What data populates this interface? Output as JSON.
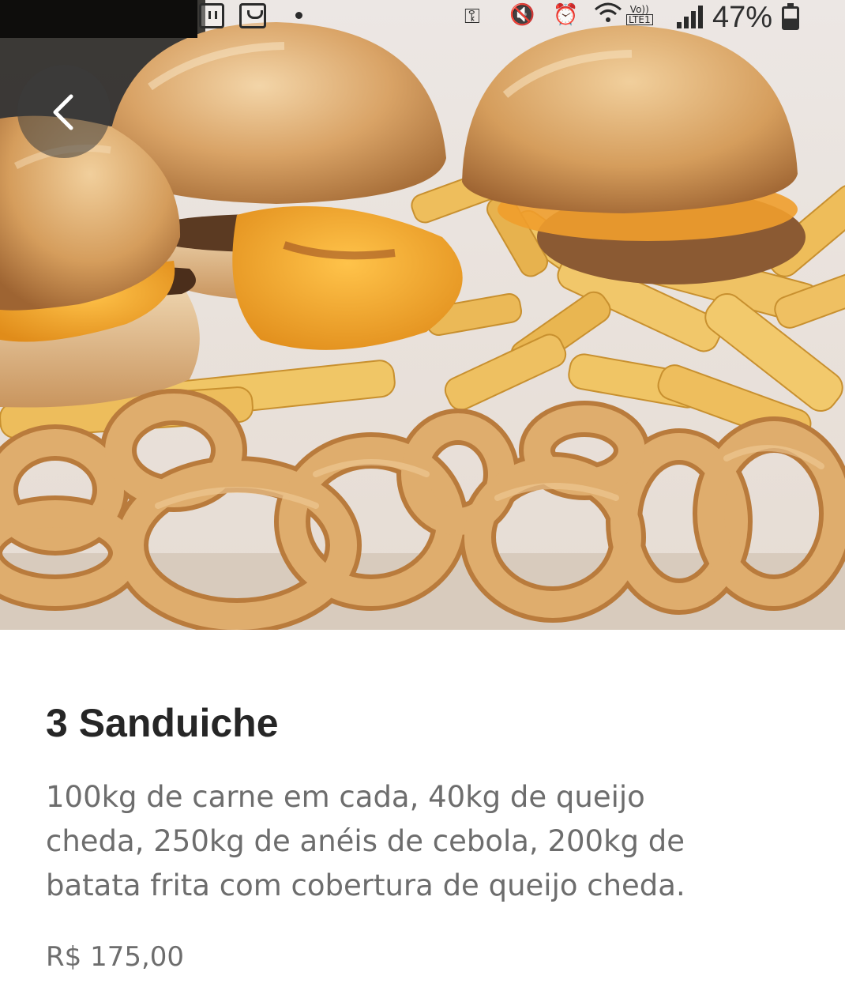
{
  "status_bar": {
    "battery_percent_text": "47%",
    "network_label_top": "Vo))",
    "network_label_bottom": "LTE1",
    "icons": [
      "twitch-icon",
      "shopping-bag-icon",
      "notification-dot-icon",
      "vpn-key-icon",
      "mute-vibrate-icon",
      "alarm-icon",
      "wifi-icon",
      "signal-icon",
      "battery-icon"
    ]
  },
  "navigation": {
    "back_icon": "chevron-left-icon"
  },
  "product": {
    "image_subject": "burgers-fries-onion-rings-photo",
    "title": "3 Sanduiche",
    "description_lines": [
      "100kg de carne em cada, 40kg de queijo",
      "cheda, 250kg de anéis de cebola, 200kg de",
      "batata frita com cobertura de queijo cheda."
    ],
    "price": "R$ 175,00"
  },
  "colors": {
    "title_text": "#262626",
    "body_text": "#6d6d6d",
    "background": "#ffffff",
    "bun": "#d9a366",
    "cheese": "#f0a524",
    "fries": "#e8b44e",
    "onion_ring": "#d7a15e"
  }
}
